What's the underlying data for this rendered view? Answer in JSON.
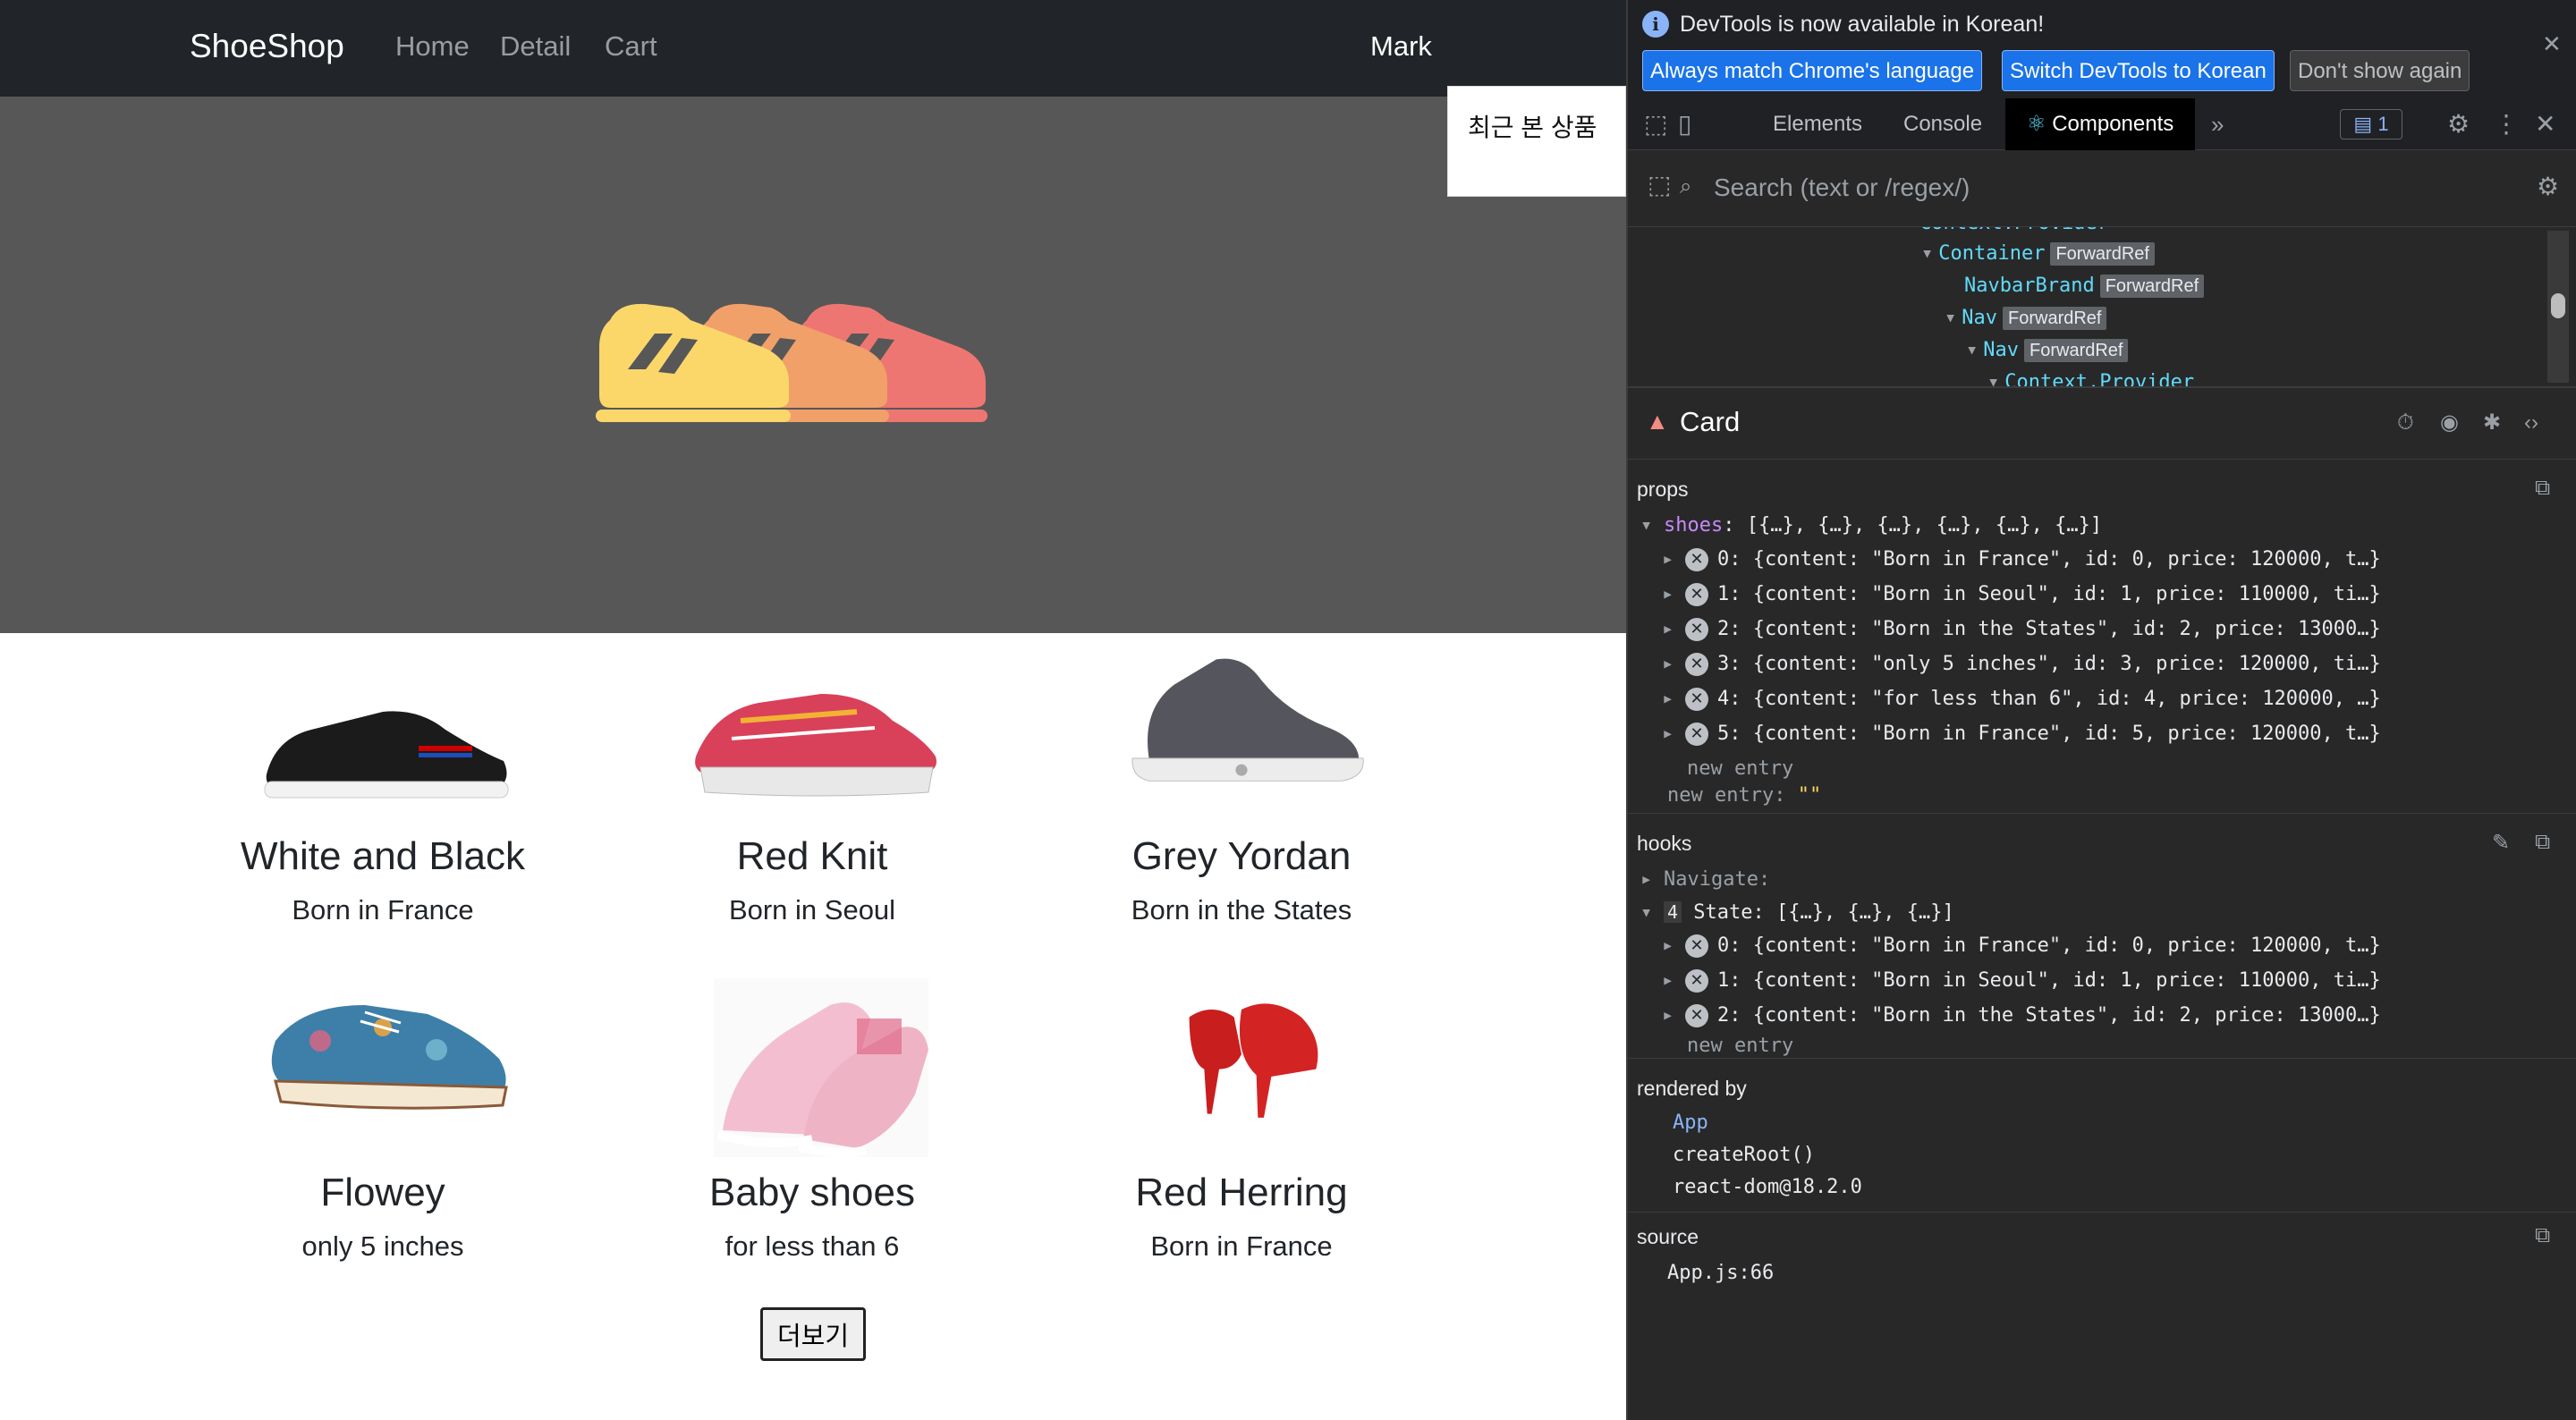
{
  "navbar": {
    "brand": "ShoeShop",
    "links": [
      "Home",
      "Detail",
      "Cart"
    ],
    "user": "Mark"
  },
  "recent_box": {
    "label": "최근 본 상품"
  },
  "products": [
    {
      "title": "White and Black",
      "content": "Born in France"
    },
    {
      "title": "Red Knit",
      "content": "Born in Seoul"
    },
    {
      "title": "Grey Yordan",
      "content": "Born in the States"
    },
    {
      "title": "Flowey",
      "content": "only 5 inches"
    },
    {
      "title": "Baby shoes",
      "content": "for less than 6"
    },
    {
      "title": "Red Herring",
      "content": "Born in France"
    }
  ],
  "more_button": "더보기",
  "devtools": {
    "info": {
      "message": "DevTools is now available in Korean!",
      "btn_match": "Always match Chrome's language",
      "btn_switch": "Switch DevTools to Korean",
      "btn_dismiss": "Don't show again"
    },
    "tabs": [
      "Elements",
      "Console",
      "Components"
    ],
    "issues_count": "1",
    "search_placeholder": "Search (text or /regex/)",
    "tree": [
      {
        "name": "Context.Provider",
        "badge": ""
      },
      {
        "name": "Container",
        "badge": "ForwardRef"
      },
      {
        "name": "NavbarBrand",
        "badge": "ForwardRef"
      },
      {
        "name": "Nav",
        "badge": "ForwardRef"
      },
      {
        "name": "Nav",
        "badge": "ForwardRef"
      },
      {
        "name": "Context.Provider",
        "badge": ""
      }
    ],
    "component_name": "Card",
    "props": {
      "label": "props",
      "shoes_key": "shoes",
      "shoes_summary": "[{…}, {…}, {…}, {…}, {…}, {…}]",
      "items": [
        "0: {content: \"Born in France\", id: 0, price: 120000, t…}",
        "1: {content: \"Born in Seoul\", id: 1, price: 110000, ti…}",
        "2: {content: \"Born in the States\", id: 2, price: 13000…}",
        "3: {content: \"only 5 inches\", id: 3, price: 120000, ti…}",
        "4: {content: \"for less than 6\", id: 4, price: 120000, …}",
        "5: {content: \"Born in France\", id: 5, price: 120000, t…}"
      ],
      "new_entry": "new entry",
      "new_entry_key": "new entry",
      "new_entry_value": "\"\""
    },
    "hooks": {
      "label": "hooks",
      "navigate": "Navigate:",
      "state_index": "4",
      "state_summary": "State: [{…}, {…}, {…}]",
      "items": [
        "0: {content: \"Born in France\", id: 0, price: 120000, t…}",
        "1: {content: \"Born in Seoul\", id: 1, price: 110000, ti…}",
        "2: {content: \"Born in the States\", id: 2, price: 13000…}"
      ],
      "new_entry": "new entry"
    },
    "rendered_by": {
      "label": "rendered by",
      "items": [
        "App",
        "createRoot()",
        "react-dom@18.2.0"
      ]
    },
    "source": {
      "label": "source",
      "file": "App.js:66"
    }
  }
}
